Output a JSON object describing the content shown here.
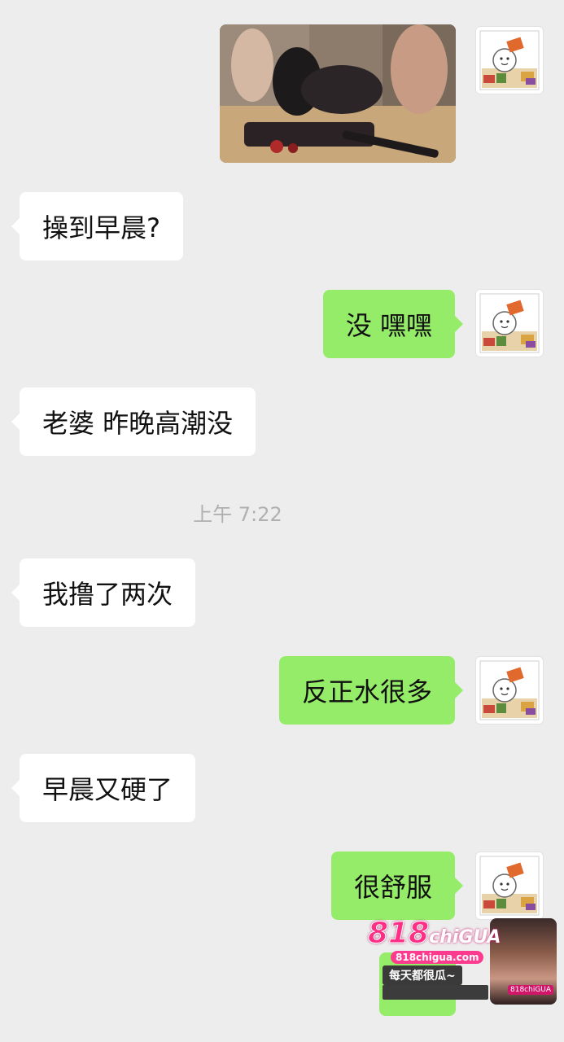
{
  "messages": [
    {
      "side": "out",
      "type": "image",
      "description": "photo"
    },
    {
      "side": "in",
      "text": "操到早晨?"
    },
    {
      "side": "out",
      "text": "没 嘿嘿"
    },
    {
      "side": "in",
      "text": "老婆 昨晚高潮没"
    },
    {
      "side": "in",
      "text": "我撸了两次"
    },
    {
      "side": "out",
      "text": "反正水很多"
    },
    {
      "side": "in",
      "text": "早晨又硬了"
    },
    {
      "side": "out",
      "text": "很舒服"
    }
  ],
  "timestamp": "上午 7:22",
  "watermark": {
    "logo_number": "818",
    "logo_word": "chiGUA",
    "url": "818chigua.com",
    "slogan": "每天都很瓜~",
    "tag": "818chiGUA"
  },
  "colors": {
    "background": "#ededed",
    "incoming_bubble": "#ffffff",
    "outgoing_bubble": "#95ec69",
    "timestamp_text": "#b0b0b0",
    "brand_pink": "#ff2f86"
  },
  "icons": {
    "avatar": "cartoon-avatar-icon",
    "bubble_tail": "bubble-tail-icon"
  }
}
